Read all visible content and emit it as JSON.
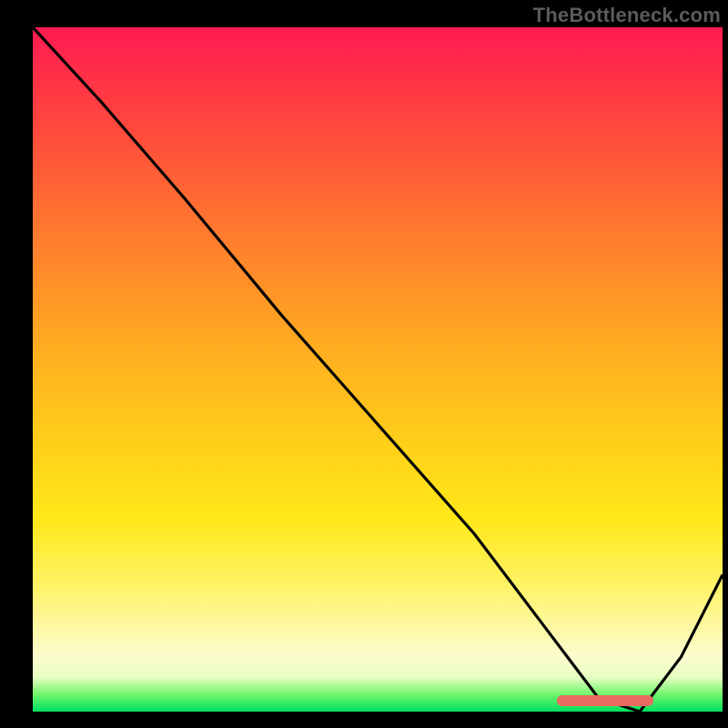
{
  "watermark": "TheBottleneck.com",
  "colors": {
    "page_bg": "#000000",
    "watermark": "#5b5b5b",
    "curve": "#000000",
    "marker": "#e86a60",
    "gradient_stops": [
      "#ff1a52",
      "#ff4040",
      "#ff7a2e",
      "#ffb020",
      "#ffd21a",
      "#ffe81a",
      "#fff36a",
      "#fbfccf",
      "#e7ffc2",
      "#70f56a",
      "#00e060"
    ]
  },
  "chart_data": {
    "type": "line",
    "title": "",
    "xlabel": "",
    "ylabel": "",
    "xlim": [
      0,
      100
    ],
    "ylim": [
      0,
      100
    ],
    "grid": false,
    "legend": false,
    "x": [
      0,
      10,
      22,
      36,
      50,
      64,
      76,
      82,
      88,
      94,
      100
    ],
    "values": [
      100,
      89,
      75,
      58,
      42,
      26,
      10,
      2,
      0,
      8,
      20
    ],
    "marker_segment": {
      "x_from": 76,
      "x_to": 90,
      "y": 0
    },
    "background": "vertical-gradient red→green"
  }
}
